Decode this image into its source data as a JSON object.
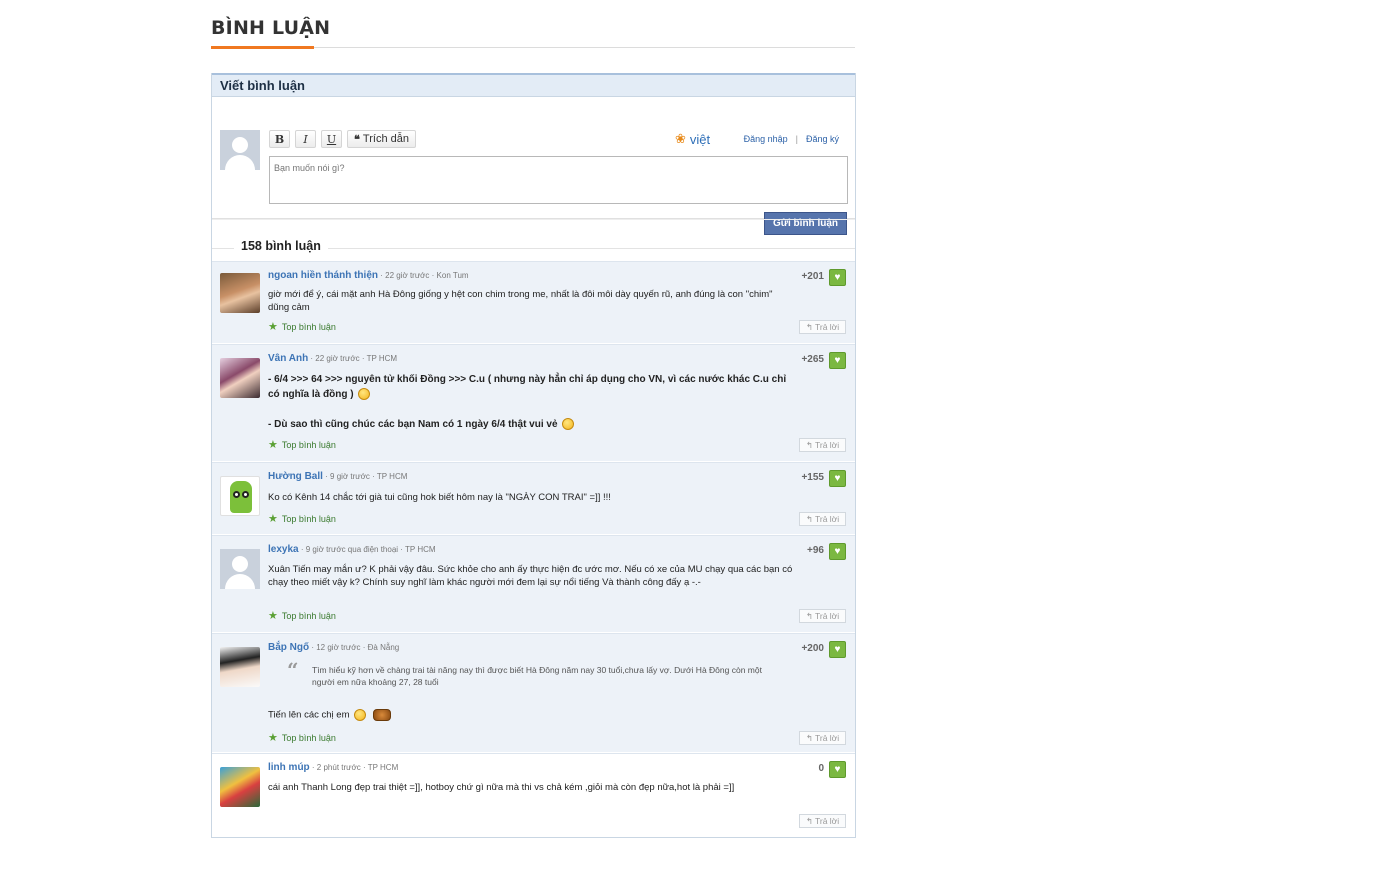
{
  "section_title": "BÌNH LUẬN",
  "compose": {
    "header": "Viết bình luận",
    "toolbar": {
      "bold": "B",
      "italic": "I",
      "underline": "U",
      "quote": "Trích dẫn"
    },
    "vietid_label": "việt",
    "login": "Đăng nhập",
    "separator": "|",
    "register": "Đăng ký",
    "placeholder": "Bạn muốn nói gì?",
    "submit": "Gửi bình luận"
  },
  "comment_count": "158 bình luận",
  "top_label": "Top bình luận",
  "reply_label": "Trả lời",
  "comments": [
    {
      "name": "ngoan hiền thánh thiện",
      "meta": "· 22 giờ trước · Kon Tum",
      "score": "+201",
      "text": "giờ mới để ý, cái mặt anh Hà Đông giống y hệt con chim trong me, nhất là đôi môi dày quyến rũ, anh đúng là con \"chim\" dũng cảm",
      "top": true
    },
    {
      "name": "Vân Anh",
      "meta": "· 22 giờ trước · TP HCM",
      "score": "+265",
      "text1": "- 6/4 >>> 64 >>> nguyên tử khối Đồng >>> C.u ( nhưng này hẳn chỉ áp dụng cho VN, vì các nước khác C.u chỉ có nghĩa là đồng )",
      "text2": "- Dù sao thì cũng chúc các bạn Nam có 1 ngày 6/4 thật vui vẻ",
      "top": true
    },
    {
      "name": "Hường Ball",
      "meta": "· 9 giờ trước · TP HCM",
      "score": "+155",
      "text": "Ko có Kênh 14 chắc tới già tui cũng hok biết hôm nay là \"NGÀY CON TRAI\" =]] !!!",
      "top": true
    },
    {
      "name": "lexyka",
      "meta": "· 9 giờ trước qua điện thoại · TP HCM",
      "score": "+96",
      "text": "Xuân Tiến may mắn ư? K phải vậy đâu. Sức khỏe cho anh ấy thực hiện đc ước mơ. Nếu có xe của MU chạy qua các bạn có chạy theo miết vậy k? Chính suy nghĩ làm khác người mới đem lại sự nổi tiếng Và thành công đấy ạ -.-",
      "top": true
    },
    {
      "name": "Bắp Ngố",
      "meta": "· 12 giờ trước · Đà Nẵng",
      "score": "+200",
      "quote": "Tìm hiểu kỹ hơn về chàng trai tài năng nay thì được biết Hà Đông năm nay 30 tuổi,chưa lấy vợ. Dưới Hà Đông còn một người em nữa khoảng 27, 28 tuổi",
      "text": "Tiến lên các chị em",
      "top": true
    },
    {
      "name": "linh múp",
      "meta": "· 2 phút trước · TP HCM",
      "score": "0",
      "text": "cái anh Thanh Long đẹp trai thiệt =]], hotboy chứ gì nữa mà thi vs chả kém ,giỏi mà còn đẹp nữa,hot là phải =]]",
      "top": false
    }
  ],
  "colors": {
    "accent": "#f07820",
    "link": "#3d74b5",
    "submit": "#5674ac",
    "like": "#7bb841"
  }
}
